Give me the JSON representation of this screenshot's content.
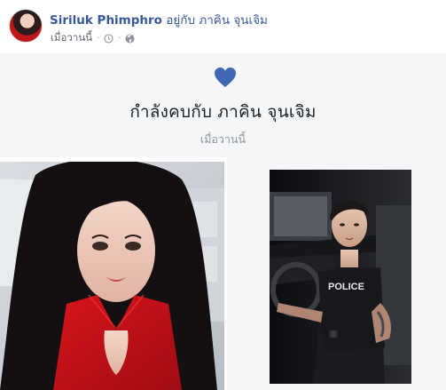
{
  "post": {
    "author_name": "Siriluk Phimphro",
    "with_text": "อยู่กับ ภาคิน จุนเจิม",
    "timestamp": "เมื่อวานนี้",
    "separator": "·",
    "privacy_icon": "globe-icon",
    "time_icon": "clock-icon",
    "more_icon": "more-options-icon"
  },
  "life_event": {
    "icon": "heart-icon",
    "title": "กำลังคบกับ ภาคิน จุนเจิม",
    "time": "เมื่อวานนี้",
    "accent_color": "#4267b2"
  },
  "photos": {
    "left_alt": "woman-in-red-dress-photo",
    "right_alt": "man-in-car-police-vest-photo",
    "vest_text": "POLICE"
  }
}
